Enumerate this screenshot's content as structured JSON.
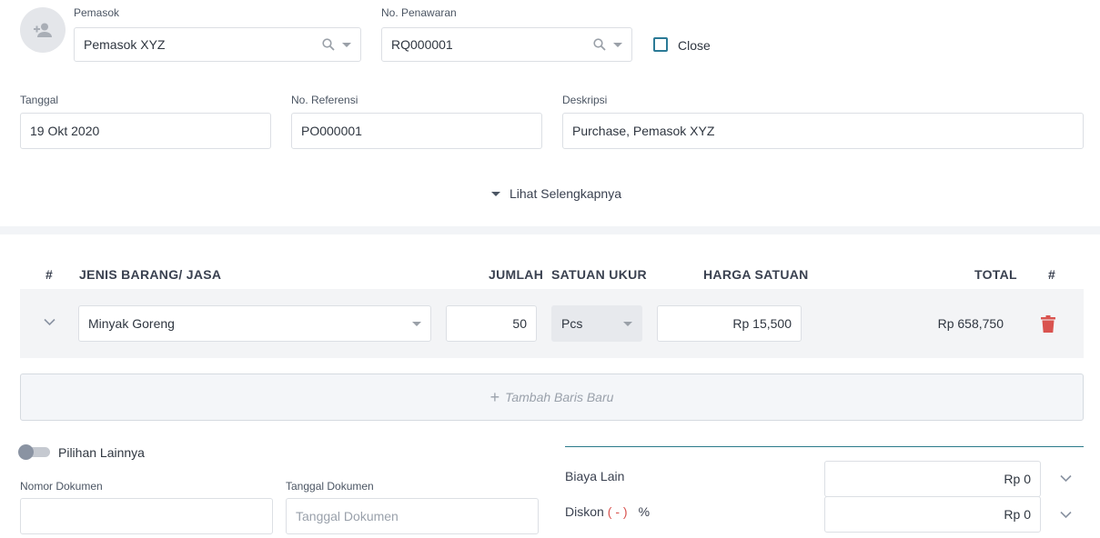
{
  "supplier": {
    "label": "Pemasok",
    "value": "Pemasok XYZ"
  },
  "quotation": {
    "label": "No. Penawaran",
    "value": "RQ000001"
  },
  "close": {
    "label": "Close",
    "checked": false
  },
  "date": {
    "label": "Tanggal",
    "value": "19 Okt 2020"
  },
  "reference": {
    "label": "No. Referensi",
    "value": "PO000001"
  },
  "description": {
    "label": "Deskripsi",
    "value": "Purchase, Pemasok XYZ"
  },
  "see_more": {
    "label": "Lihat Selengkapnya"
  },
  "table": {
    "headers": {
      "num": "#",
      "item": "JENIS BARANG/ JASA",
      "qty": "JUMLAH",
      "unit": "SATUAN UKUR",
      "price": "HARGA SATUAN",
      "total": "TOTAL",
      "action": "#"
    },
    "rows": [
      {
        "item": "Minyak Goreng",
        "qty": "50",
        "unit": "Pcs",
        "price": "Rp 15,500",
        "total": "Rp 658,750"
      }
    ],
    "add_row_label": "Tambah Baris Baru"
  },
  "other_options": {
    "label": "Pilihan Lainnya",
    "on": false
  },
  "doc_number": {
    "label": "Nomor Dokumen",
    "value": ""
  },
  "doc_date": {
    "label": "Tanggal Dokumen",
    "placeholder": "Tanggal Dokumen"
  },
  "other_cost": {
    "label": "Biaya Lain",
    "value": "Rp 0"
  },
  "discount": {
    "label": "Diskon",
    "minus": "( - )",
    "percent": "%",
    "value": "Rp 0"
  },
  "colors": {
    "accent": "#2b7a96",
    "danger": "#d9534f",
    "divider": "#2b7a8a"
  }
}
